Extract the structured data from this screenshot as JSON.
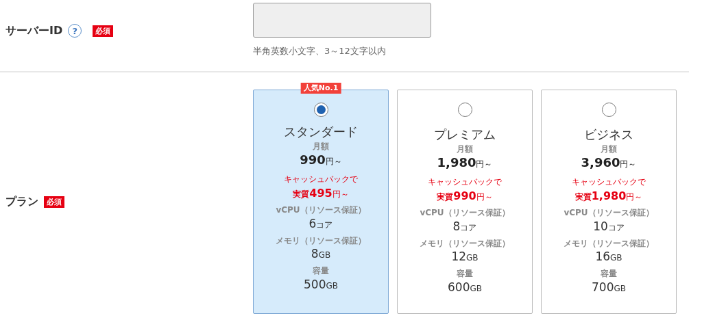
{
  "server_id": {
    "label": "サーバーID",
    "help": "?",
    "required": "必須",
    "hint": "半角英数小文字、3～12文字以内"
  },
  "plan": {
    "label": "プラン",
    "required": "必須",
    "options": [
      {
        "name": "スタンダード",
        "selected": true,
        "badge": "人気No.1",
        "price_label": "月額",
        "price": "990",
        "price_unit": "円～",
        "cashback": "キャッシュバックで",
        "real_prefix": "実質",
        "real_price": "495",
        "real_unit": "円～",
        "specs": [
          {
            "label": "vCPU（リソース保証）",
            "value": "6",
            "unit": "コア"
          },
          {
            "label": "メモリ（リソース保証）",
            "value": "8",
            "unit": "GB"
          },
          {
            "label": "容量",
            "value": "500",
            "unit": "GB"
          }
        ]
      },
      {
        "name": "プレミアム",
        "selected": false,
        "price_label": "月額",
        "price": "1,980",
        "price_unit": "円～",
        "cashback": "キャッシュバックで",
        "real_prefix": "実質",
        "real_price": "990",
        "real_unit": "円～",
        "specs": [
          {
            "label": "vCPU（リソース保証）",
            "value": "8",
            "unit": "コア"
          },
          {
            "label": "メモリ（リソース保証）",
            "value": "12",
            "unit": "GB"
          },
          {
            "label": "容量",
            "value": "600",
            "unit": "GB"
          }
        ]
      },
      {
        "name": "ビジネス",
        "selected": false,
        "price_label": "月額",
        "price": "3,960",
        "price_unit": "円～",
        "cashback": "キャッシュバックで",
        "real_prefix": "実質",
        "real_price": "1,980",
        "real_unit": "円～",
        "specs": [
          {
            "label": "vCPU（リソース保証）",
            "value": "10",
            "unit": "コア"
          },
          {
            "label": "メモリ（リソース保証）",
            "value": "16",
            "unit": "GB"
          },
          {
            "label": "容量",
            "value": "700",
            "unit": "GB"
          }
        ]
      }
    ]
  }
}
